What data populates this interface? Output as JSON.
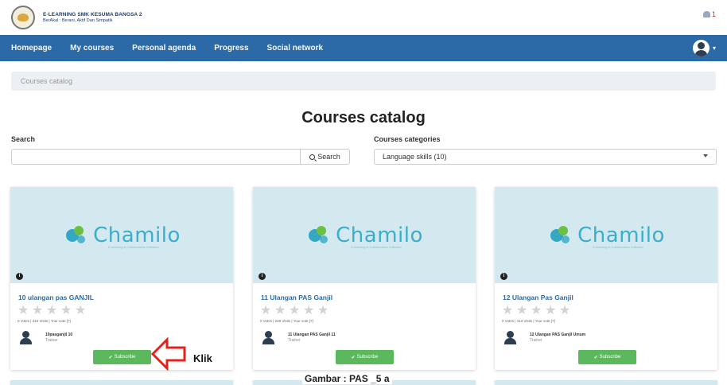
{
  "header": {
    "school_name": "E-LEARNING SMK KESUMA BANGSA 2",
    "slogan": "BerAkal : Berani, Aktif Dan Simpatik",
    "notification_count": "1"
  },
  "nav": {
    "items": [
      "Homepage",
      "My courses",
      "Personal agenda",
      "Progress",
      "Social network"
    ],
    "user_caret": "▾"
  },
  "breadcrumb": "Courses catalog",
  "page_title": "Courses catalog",
  "filters": {
    "search_label": "Search",
    "search_value": "",
    "search_button": "Search",
    "categories_label": "Courses categories",
    "categories_selected": "Language skills (10)"
  },
  "logo_text": "Chamilo",
  "logo_subtext": "E-learning & Collaboration Software",
  "courses": [
    {
      "title": "10 ulangan pas GANJIL",
      "stats": "0 Votes | 316 Visits | Your vote [?]",
      "teacher": "10pasganjil 10",
      "role": "Trainer",
      "subscribe": "Subscribe"
    },
    {
      "title": "11 Ulangan PAS Ganjil",
      "stats": "0 Votes | 228 Visits | Your vote [?]",
      "teacher": "11 Ulangan PAS Ganjil 11",
      "role": "Trainer",
      "subscribe": "Subscribe"
    },
    {
      "title": "12 Ulangan Pas Ganjil",
      "stats": "0 Votes | 413 Visits | Your vote [?]",
      "teacher": "12 Ulangan PAS Ganjil Umum",
      "role": "Trainer",
      "subscribe": "Subscribe"
    }
  ],
  "annotation": {
    "klik": "Klik",
    "caption": "Gambar : PAS _5 a"
  },
  "colors": {
    "navbar": "#2c6aa7",
    "subscribe": "#5cb85c",
    "card_image_bg": "#d4e9ef",
    "annotation_arrow": "#e0241b"
  },
  "icons": [
    "school-logo-icon",
    "notification-icon",
    "user-avatar-icon",
    "search-icon",
    "dropdown-arrow-icon",
    "info-icon",
    "star-icon",
    "teacher-avatar-icon",
    "check-icon",
    "red-arrow-icon"
  ]
}
